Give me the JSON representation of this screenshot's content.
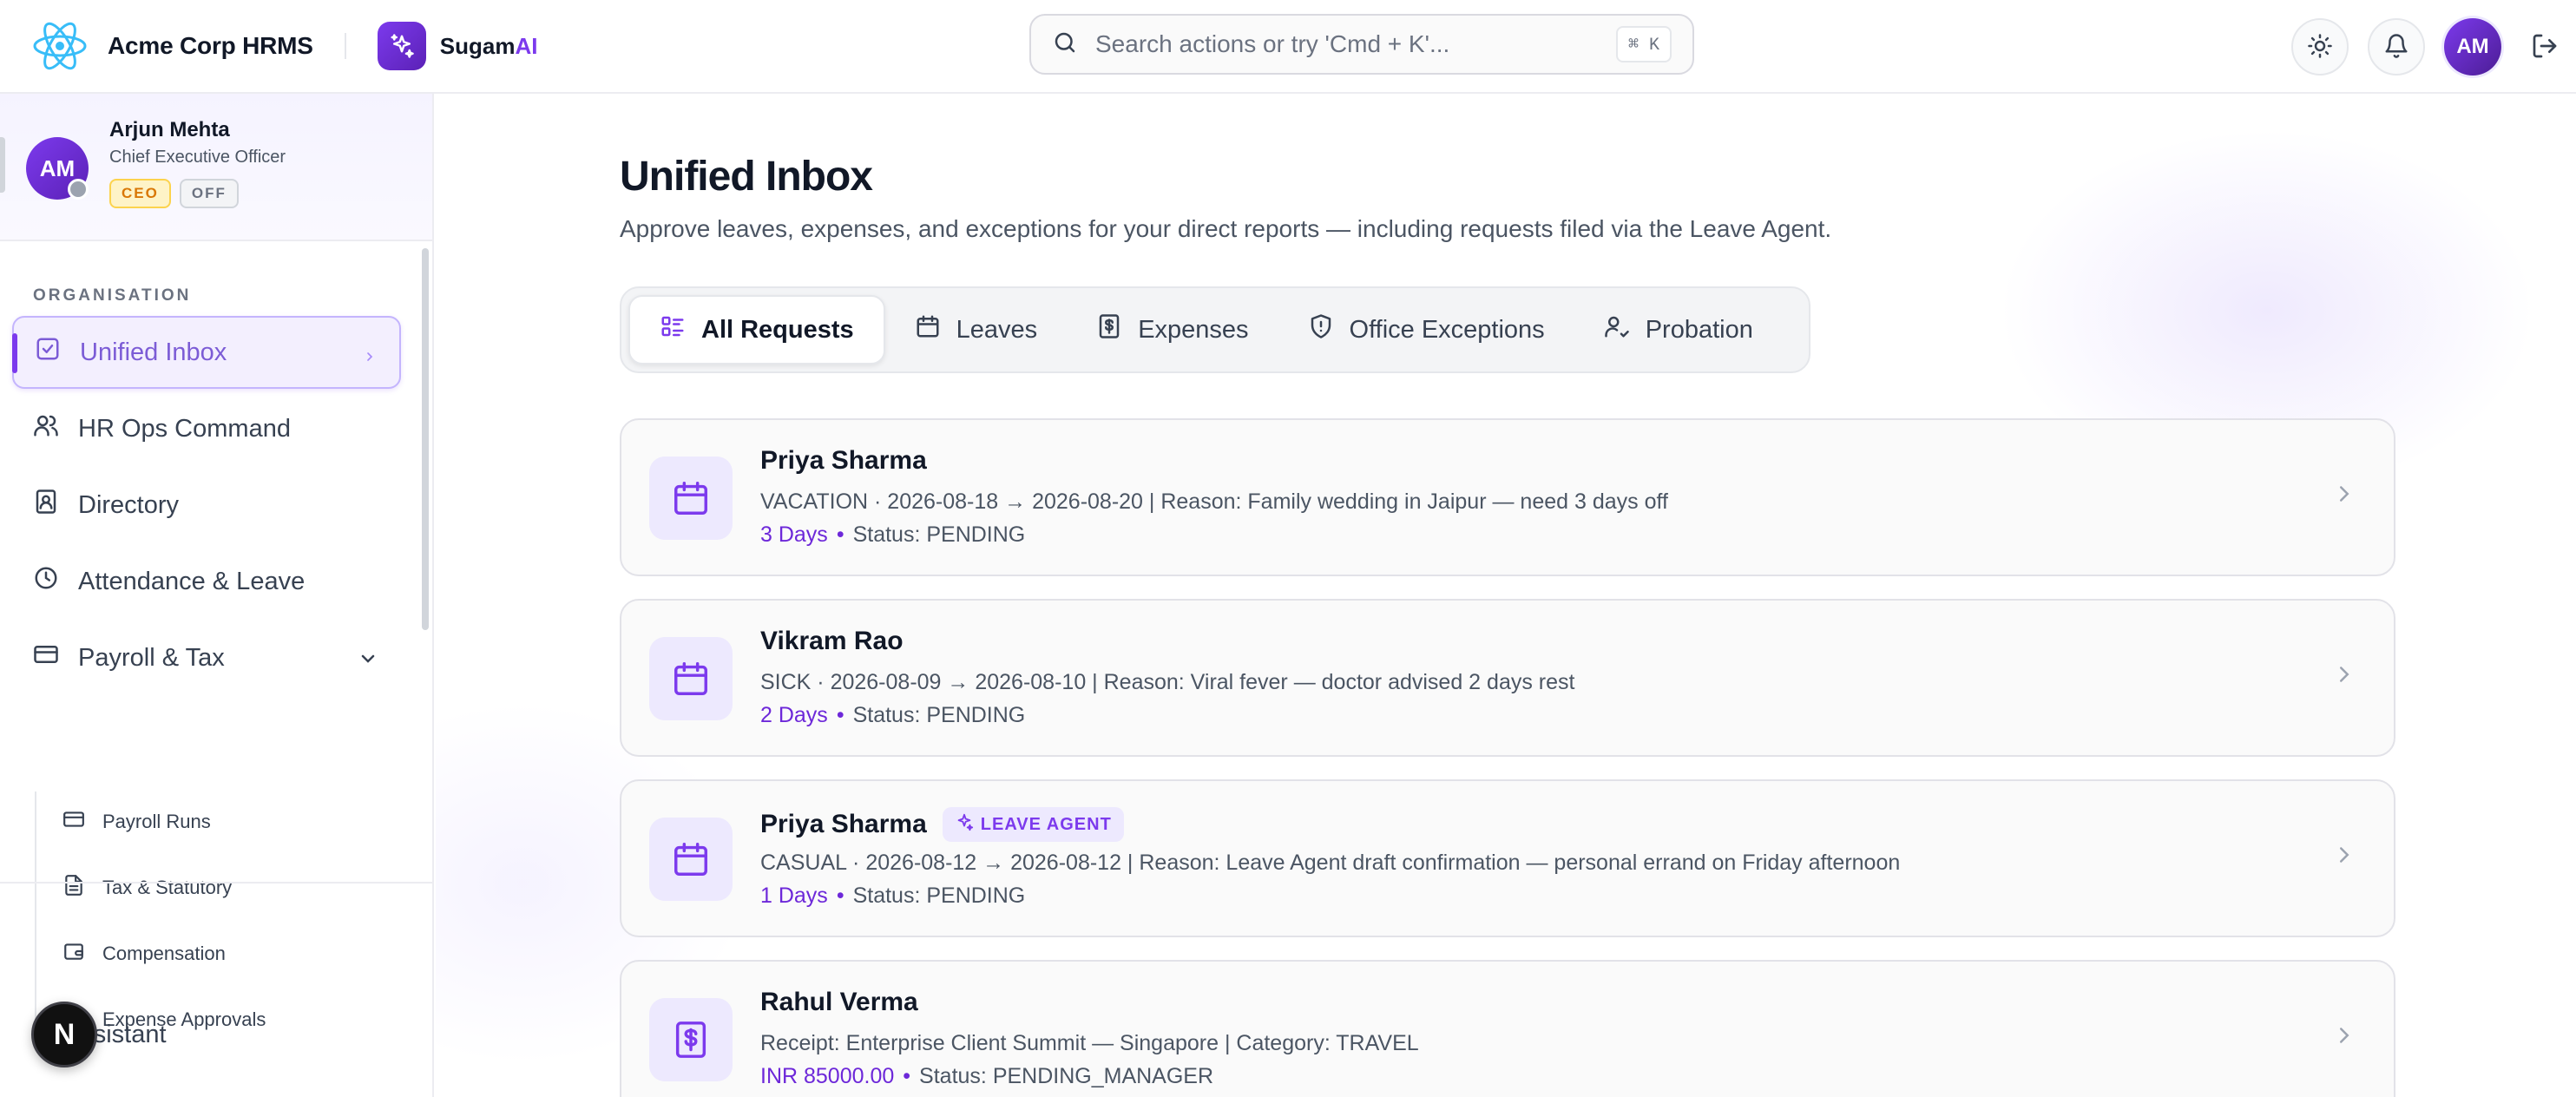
{
  "header": {
    "brand_name": "Acme Corp HRMS",
    "assistant_name": "Sugam",
    "assistant_suffix": "AI",
    "search_placeholder": "Search actions or try 'Cmd + K'...",
    "shortcut": "⌘ K",
    "avatar_initials": "AM",
    "icons": [
      "react-logo-icon",
      "sparkle-icon",
      "search-icon",
      "sun-icon",
      "bell-icon",
      "logout-icon"
    ]
  },
  "profile": {
    "name": "Arjun Mehta",
    "role": "Chief Executive Officer",
    "initials": "AM",
    "tags": [
      "CEO",
      "OFF"
    ]
  },
  "sidebar": {
    "section": "ORGANISATION",
    "items": [
      {
        "label": "Unified Inbox",
        "icon": "checkbox-icon",
        "active": true
      },
      {
        "label": "HR Ops Command",
        "icon": "users-icon"
      },
      {
        "label": "Directory",
        "icon": "contact-card-icon"
      },
      {
        "label": "Attendance & Leave",
        "icon": "clock-icon"
      },
      {
        "label": "Payroll & Tax",
        "icon": "credit-card-icon",
        "expanded": true
      }
    ],
    "sub_items": [
      {
        "label": "Payroll Runs",
        "icon": "credit-card-icon"
      },
      {
        "label": "Tax & Statutory",
        "icon": "document-icon"
      },
      {
        "label": "Compensation",
        "icon": "wallet-icon"
      },
      {
        "label": "Expense Approvals",
        "icon": "receipt-icon"
      }
    ],
    "assistant_label": "AI Assistant",
    "n_badge": "N"
  },
  "main": {
    "title": "Unified Inbox",
    "subtitle": "Approve leaves, expenses, and exceptions for your direct reports — including requests filed via the Leave Agent.",
    "tabs": [
      {
        "label": "All Requests",
        "icon": "list-icon",
        "active": true
      },
      {
        "label": "Leaves",
        "icon": "calendar-icon"
      },
      {
        "label": "Expenses",
        "icon": "receipt-icon"
      },
      {
        "label": "Office Exceptions",
        "icon": "shield-icon"
      },
      {
        "label": "Probation",
        "icon": "user-check-icon"
      }
    ],
    "requests": [
      {
        "name": "Priya Sharma",
        "badge": "",
        "detail": "VACATION · 2026-08-18 → 2026-08-20 | Reason: Family wedding in Jaipur — need 3 days off",
        "amount": "3 Days",
        "status": "Status: PENDING",
        "icon": "calendar-icon"
      },
      {
        "name": "Vikram Rao",
        "badge": "",
        "detail": "SICK · 2026-08-09 → 2026-08-10 | Reason: Viral fever — doctor advised 2 days rest",
        "amount": "2 Days",
        "status": "Status: PENDING",
        "icon": "calendar-icon"
      },
      {
        "name": "Priya Sharma",
        "badge": "LEAVE AGENT",
        "detail": "CASUAL · 2026-08-12 → 2026-08-12 | Reason: Leave Agent draft confirmation — personal errand on Friday afternoon",
        "amount": "1 Days",
        "status": "Status: PENDING",
        "icon": "calendar-icon"
      },
      {
        "name": "Rahul Verma",
        "badge": "",
        "detail": "Receipt: Enterprise Client Summit — Singapore | Category: TRAVEL",
        "amount": "INR 85000.00",
        "status": "Status: PENDING_MANAGER",
        "icon": "receipt-icon"
      }
    ],
    "separator": "•"
  },
  "colors": {
    "accent": "#7c3aed",
    "accent_soft": "#ede9fe",
    "ceo_tag": "#d97706",
    "border": "#e2e2e8"
  }
}
